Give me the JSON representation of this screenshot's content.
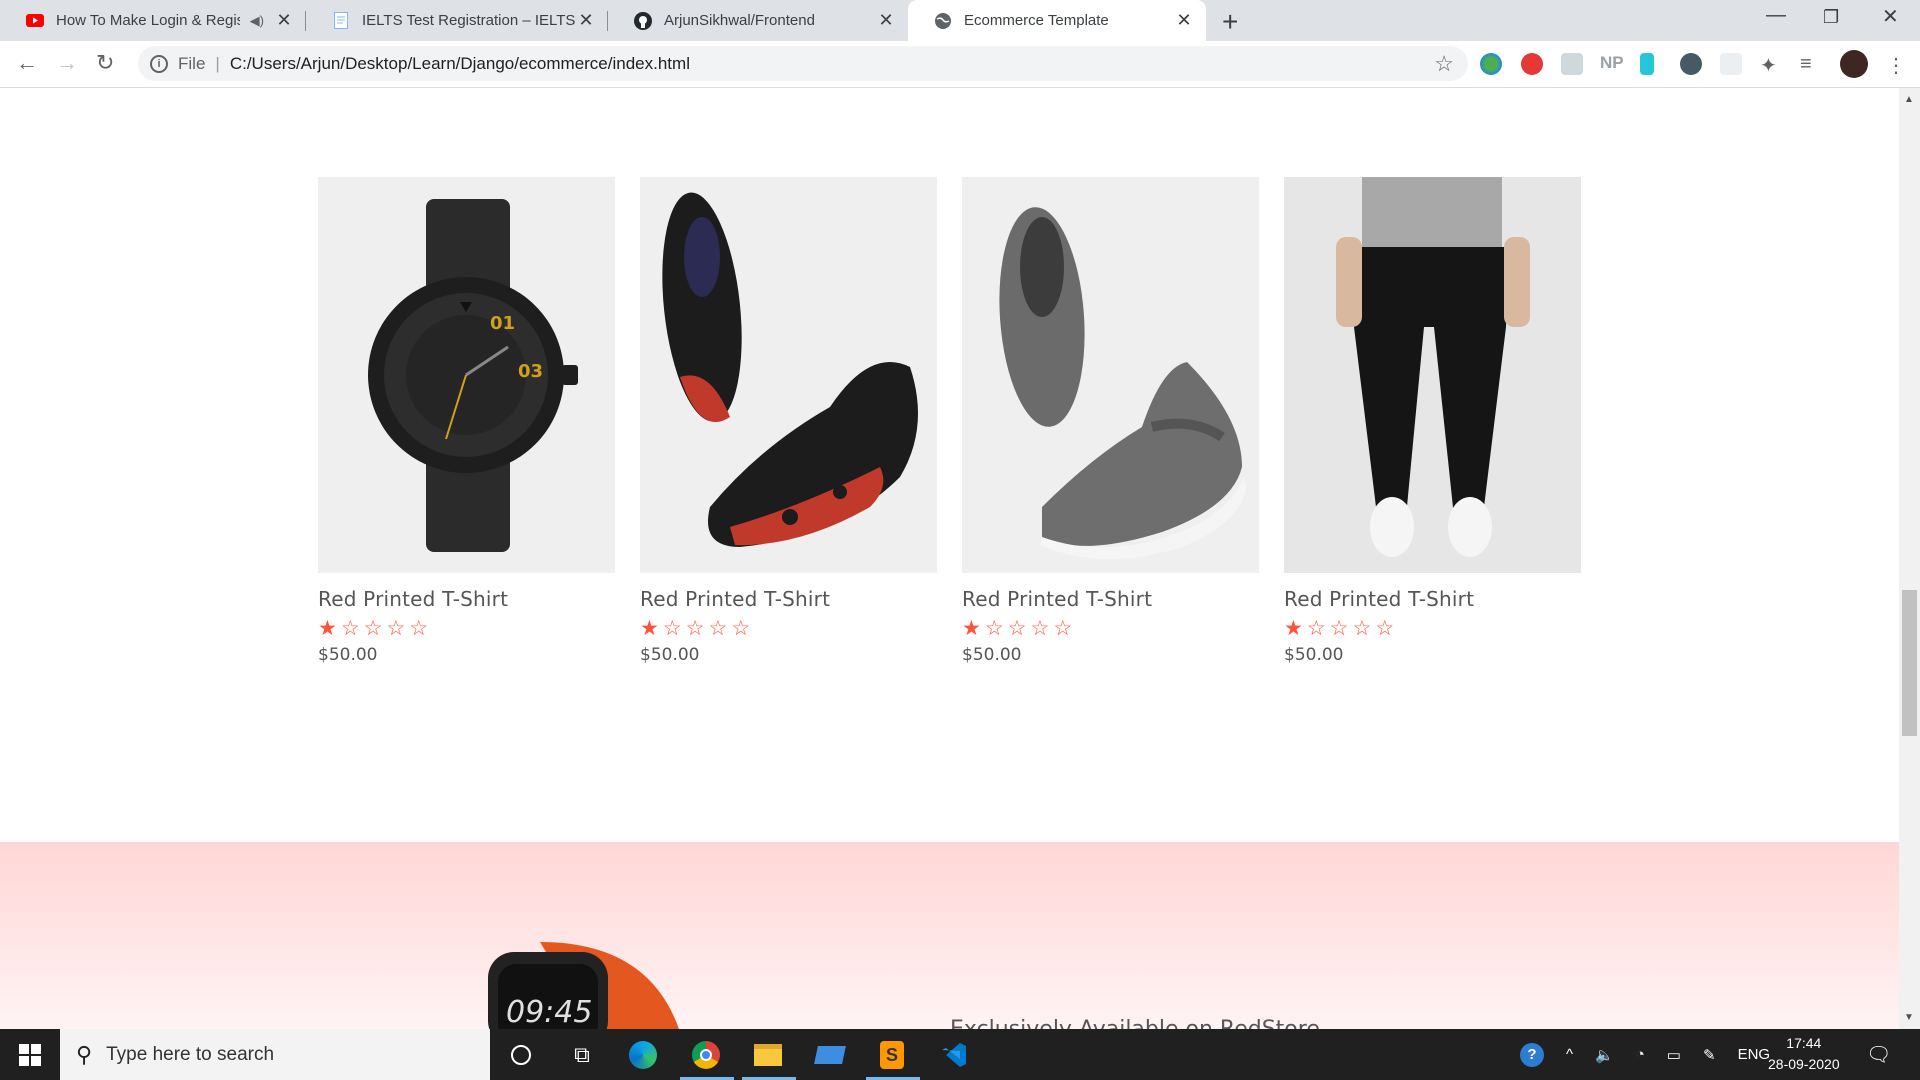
{
  "browser": {
    "tabs": [
      {
        "title": "How To Make Login & Regist",
        "favicon": "youtube-icon"
      },
      {
        "title": "IELTS Test Registration – IELTS IDI",
        "favicon": "document-icon"
      },
      {
        "title": "ArjunSikhwal/Frontend",
        "favicon": "github-icon"
      },
      {
        "title": "Ecommerce Template",
        "favicon": "globe-icon"
      }
    ],
    "address": {
      "scheme_label": "File",
      "url": "C:/Users/Arjun/Desktop/Learn/Django/ecommerce/index.html"
    },
    "extensions": [
      "np-label"
    ],
    "np_label": "NP"
  },
  "products": [
    {
      "name": "Red Printed T-Shirt",
      "price": "$50.00",
      "rating": 1,
      "max_rating": 5,
      "image": "watch"
    },
    {
      "name": "Red Printed T-Shirt",
      "price": "$50.00",
      "rating": 1,
      "max_rating": 5,
      "image": "black-red-shoes"
    },
    {
      "name": "Red Printed T-Shirt",
      "price": "$50.00",
      "rating": 1,
      "max_rating": 5,
      "image": "grey-shoes"
    },
    {
      "name": "Red Printed T-Shirt",
      "price": "$50.00",
      "rating": 1,
      "max_rating": 5,
      "image": "black-joggers"
    }
  ],
  "offer": {
    "tagline": "Exclusively Available on RedStore",
    "watch_time": "09:45"
  },
  "taskbar": {
    "search_placeholder": "Type here to search",
    "language": "ENG",
    "time": "17:44",
    "date": "28-09-2020"
  },
  "colors": {
    "accent": "#ff523b",
    "offer_bg": "#ffd6d6"
  }
}
